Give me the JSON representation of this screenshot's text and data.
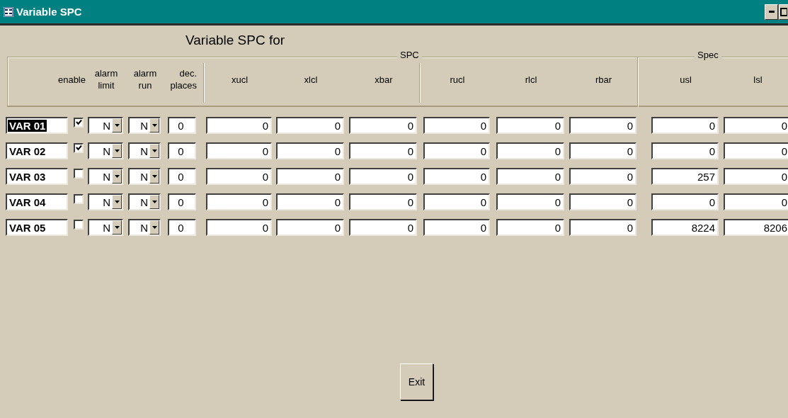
{
  "window": {
    "title": "Variable SPC"
  },
  "heading": "Variable SPC for",
  "groups": [
    {
      "label": "SPC"
    },
    {
      "label": "Spec"
    }
  ],
  "columns": [
    {
      "label": "enable"
    },
    {
      "label": "alarm limit"
    },
    {
      "label": "alarm run"
    },
    {
      "label": "dec. places"
    },
    {
      "label": "xucl"
    },
    {
      "label": "xlcl"
    },
    {
      "label": "xbar"
    },
    {
      "label": "rucl"
    },
    {
      "label": "rlcl"
    },
    {
      "label": "rbar"
    },
    {
      "label": "usl"
    },
    {
      "label": "lsl"
    }
  ],
  "rows": [
    {
      "name": "VAR 01",
      "selected": true,
      "enabled": true,
      "alarm_limit": "N",
      "alarm_run": "N",
      "dec_places": "0",
      "values": [
        "0",
        "0",
        "0",
        "0",
        "0",
        "0",
        "0",
        "0"
      ]
    },
    {
      "name": "VAR 02",
      "selected": false,
      "enabled": true,
      "alarm_limit": "N",
      "alarm_run": "N",
      "dec_places": "0",
      "values": [
        "0",
        "0",
        "0",
        "0",
        "0",
        "0",
        "0",
        "0"
      ]
    },
    {
      "name": "VAR 03",
      "selected": false,
      "enabled": false,
      "alarm_limit": "N",
      "alarm_run": "N",
      "dec_places": "0",
      "values": [
        "0",
        "0",
        "0",
        "0",
        "0",
        "0",
        "257",
        "0"
      ]
    },
    {
      "name": "VAR 04",
      "selected": false,
      "enabled": false,
      "alarm_limit": "N",
      "alarm_run": "N",
      "dec_places": "0",
      "values": [
        "0",
        "0",
        "0",
        "0",
        "0",
        "0",
        "0",
        "0"
      ]
    },
    {
      "name": "VAR 05",
      "selected": false,
      "enabled": false,
      "alarm_limit": "N",
      "alarm_run": "N",
      "dec_places": "0",
      "values": [
        "0",
        "0",
        "0",
        "0",
        "0",
        "0",
        "8224",
        "8206"
      ]
    }
  ],
  "exit_button": "Exit"
}
